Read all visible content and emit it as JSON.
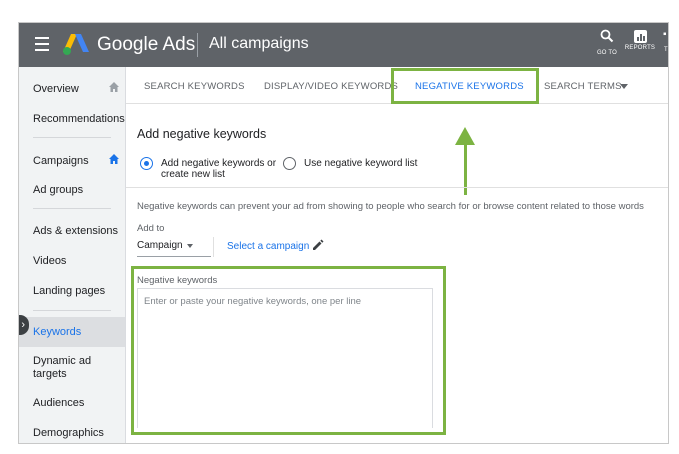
{
  "app": {
    "brand": "Google Ads",
    "page_title": "All campaigns"
  },
  "toolbar": {
    "goto_label": "GO TO",
    "reports_label": "REPORTS",
    "edge_label": "T"
  },
  "sidebar": {
    "items": [
      {
        "label": "Overview"
      },
      {
        "label": "Recommendations"
      },
      {
        "label": "Campaigns"
      },
      {
        "label": "Ad groups"
      },
      {
        "label": "Ads & extensions"
      },
      {
        "label": "Videos"
      },
      {
        "label": "Landing pages"
      },
      {
        "label": "Keywords"
      },
      {
        "label": "Dynamic ad targets"
      },
      {
        "label": "Audiences"
      },
      {
        "label": "Demographics"
      }
    ],
    "active": "Keywords"
  },
  "tabs": [
    {
      "label": "SEARCH KEYWORDS"
    },
    {
      "label": "DISPLAY/VIDEO KEYWORDS"
    },
    {
      "label": "NEGATIVE KEYWORDS"
    },
    {
      "label": "SEARCH TERMS"
    }
  ],
  "main": {
    "section_title": "Add negative keywords",
    "radio_options": [
      {
        "label_line1": "Add negative keywords or",
        "label_line2": "create new list",
        "checked": true
      },
      {
        "label_line1": "Use negative keyword list",
        "checked": false
      }
    ],
    "description": "Negative keywords can prevent your ad from showing to people who search for or browse content related to those words",
    "add_to_label": "Add to",
    "add_to_value": "Campaign",
    "select_campaign_link": "Select a campaign",
    "keywords_label": "Negative keywords",
    "keywords_placeholder": "Enter or paste your negative keywords, one per line",
    "keywords_value": ""
  },
  "colors": {
    "topbar": "#5f6368",
    "accent": "#1a73e8",
    "highlight": "#7cb342",
    "sidebar_bg": "#f1f3f4"
  }
}
